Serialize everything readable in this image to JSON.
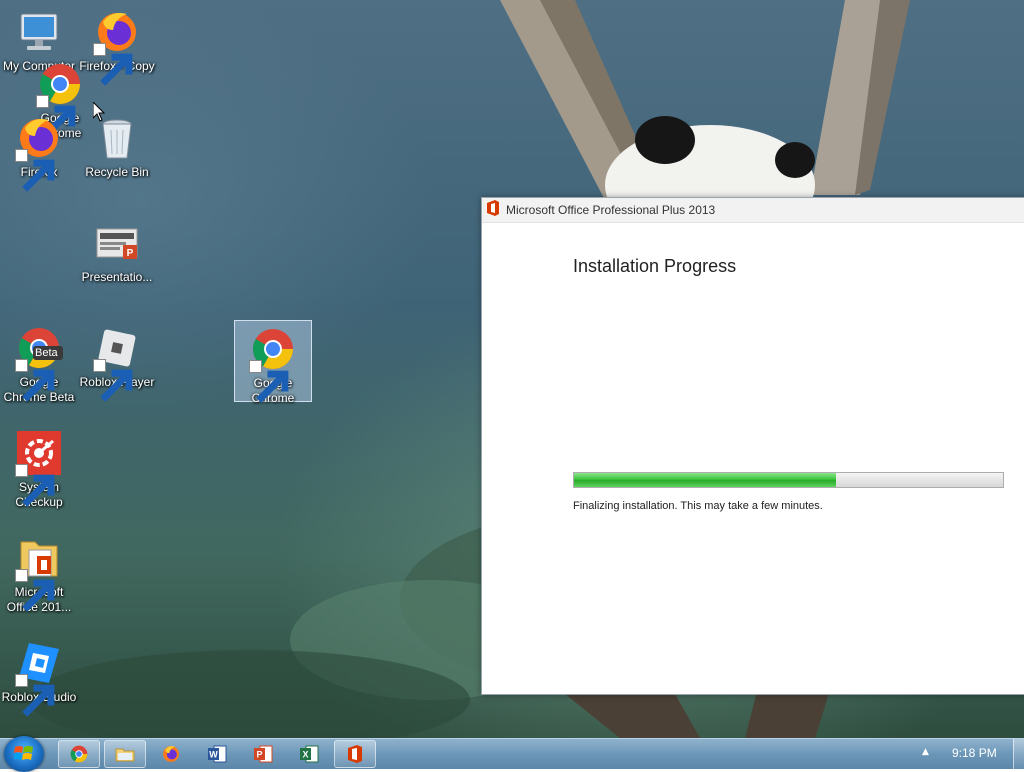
{
  "desktop": {
    "icons": [
      {
        "label": "My Computer",
        "icon": "computer-icon"
      },
      {
        "label": "Firefox - Copy",
        "icon": "firefox-icon"
      },
      {
        "label": "Google Chrome",
        "icon": "chrome-icon"
      },
      {
        "label": "Firefox",
        "icon": "firefox-icon"
      },
      {
        "label": "Recycle Bin",
        "icon": "recycle-bin-icon"
      },
      {
        "label": "Presentatio...",
        "icon": "powerpoint-file-icon"
      },
      {
        "label": "Google Chrome Beta",
        "icon": "chrome-beta-icon",
        "badge": "Beta"
      },
      {
        "label": "Roblox Player",
        "icon": "roblox-player-icon"
      },
      {
        "label": "Google Chrome",
        "icon": "chrome-icon"
      },
      {
        "label": "System Checkup",
        "icon": "system-checkup-icon"
      },
      {
        "label": "Microsoft Office 201...",
        "icon": "office-installer-icon"
      },
      {
        "label": "Roblox Studio",
        "icon": "roblox-studio-icon"
      }
    ]
  },
  "installer": {
    "title": "Microsoft Office Professional Plus 2013",
    "heading": "Installation Progress",
    "progress_percent": 61,
    "status": "Finalizing installation. This may take a few minutes."
  },
  "taskbar": {
    "buttons": [
      {
        "icon": "chrome-icon"
      },
      {
        "icon": "file-explorer-icon"
      },
      {
        "icon": "firefox-icon"
      },
      {
        "icon": "word-icon"
      },
      {
        "icon": "powerpoint-icon"
      },
      {
        "icon": "excel-icon"
      },
      {
        "icon": "office-icon",
        "active": true
      }
    ],
    "clock": "9:18 PM"
  },
  "colors": {
    "progress_green": "#3cc43c",
    "office_red": "#d83b01",
    "taskbar_blue": "#6d97b8"
  }
}
